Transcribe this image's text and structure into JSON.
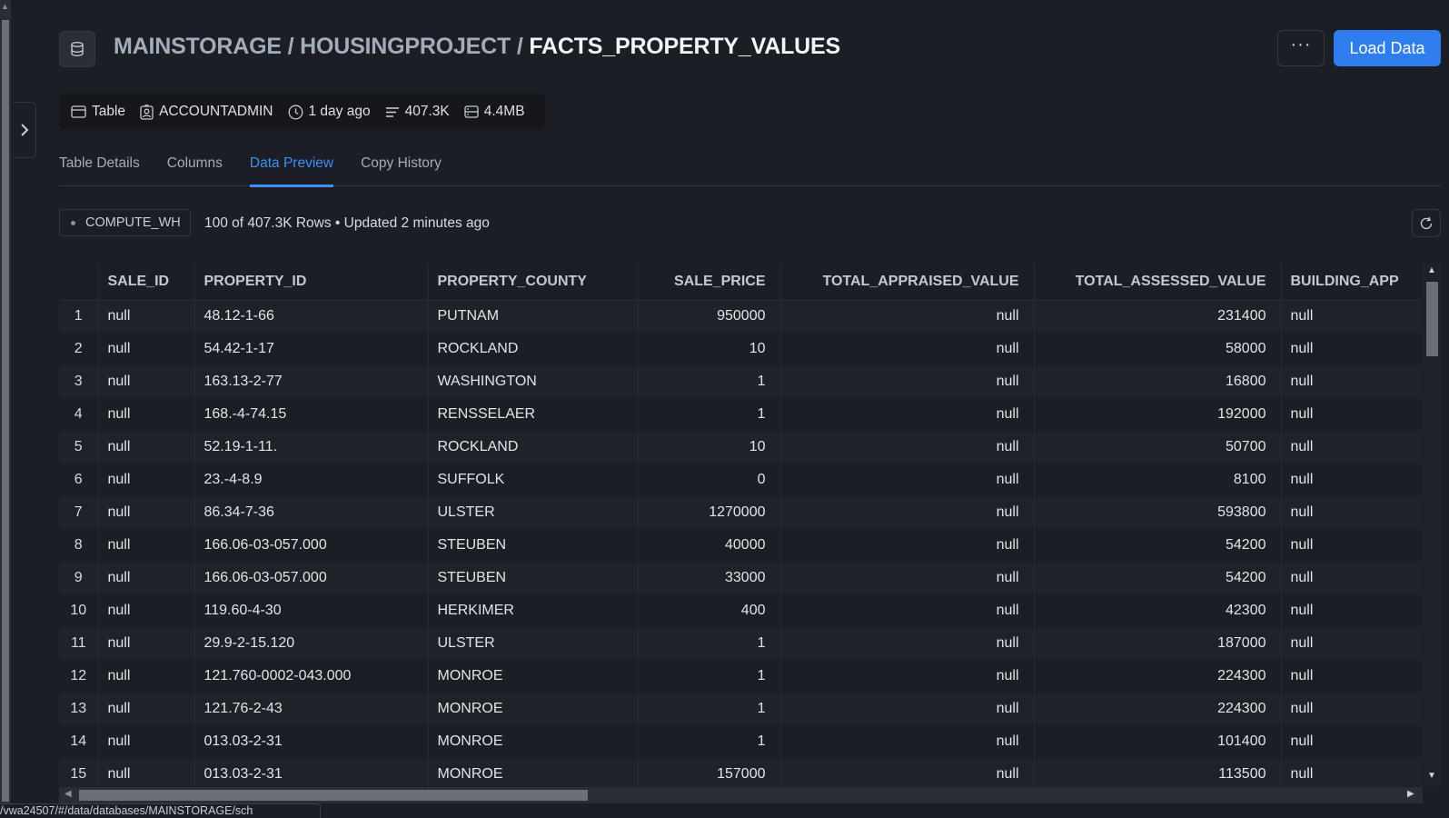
{
  "breadcrumb": {
    "database": "MAINSTORAGE",
    "schema": "HOUSINGPROJECT",
    "table": "FACTS_PROPERTY_VALUES",
    "separator": " / "
  },
  "header": {
    "more_label": "···",
    "load_label": "Load Data"
  },
  "meta": {
    "type": "Table",
    "owner": "ACCOUNTADMIN",
    "modified": "1 day ago",
    "rows": "407.3K",
    "size": "4.4MB"
  },
  "tabs": [
    "Table Details",
    "Columns",
    "Data Preview",
    "Copy History"
  ],
  "active_tab": "Data Preview",
  "preview": {
    "warehouse": "COMPUTE_WH",
    "summary": "100 of 407.3K Rows • Updated 2 minutes ago"
  },
  "table": {
    "columns": [
      "SALE_ID",
      "PROPERTY_ID",
      "PROPERTY_COUNTY",
      "SALE_PRICE",
      "TOTAL_APPRAISED_VALUE",
      "TOTAL_ASSESSED_VALUE",
      "BUILDING_APP"
    ],
    "rows": [
      [
        "1",
        "null",
        "48.12-1-66",
        "PUTNAM",
        "950000",
        "null",
        "231400",
        "null"
      ],
      [
        "2",
        "null",
        "54.42-1-17",
        "ROCKLAND",
        "10",
        "null",
        "58000",
        "null"
      ],
      [
        "3",
        "null",
        "163.13-2-77",
        "WASHINGTON",
        "1",
        "null",
        "16800",
        "null"
      ],
      [
        "4",
        "null",
        "168.-4-74.15",
        "RENSSELAER",
        "1",
        "null",
        "192000",
        "null"
      ],
      [
        "5",
        "null",
        "52.19-1-11.",
        "ROCKLAND",
        "10",
        "null",
        "50700",
        "null"
      ],
      [
        "6",
        "null",
        "23.-4-8.9",
        "SUFFOLK",
        "0",
        "null",
        "8100",
        "null"
      ],
      [
        "7",
        "null",
        "86.34-7-36",
        "ULSTER",
        "1270000",
        "null",
        "593800",
        "null"
      ],
      [
        "8",
        "null",
        "166.06-03-057.000",
        "STEUBEN",
        "40000",
        "null",
        "54200",
        "null"
      ],
      [
        "9",
        "null",
        "166.06-03-057.000",
        "STEUBEN",
        "33000",
        "null",
        "54200",
        "null"
      ],
      [
        "10",
        "null",
        "119.60-4-30",
        "HERKIMER",
        "400",
        "null",
        "42300",
        "null"
      ],
      [
        "11",
        "null",
        "29.9-2-15.120",
        "ULSTER",
        "1",
        "null",
        "187000",
        "null"
      ],
      [
        "12",
        "null",
        "121.760-0002-043.000",
        "MONROE",
        "1",
        "null",
        "224300",
        "null"
      ],
      [
        "13",
        "null",
        "121.76-2-43",
        "MONROE",
        "1",
        "null",
        "224300",
        "null"
      ],
      [
        "14",
        "null",
        "013.03-2-31",
        "MONROE",
        "1",
        "null",
        "101400",
        "null"
      ],
      [
        "15",
        "null",
        "013.03-2-31",
        "MONROE",
        "157000",
        "null",
        "113500",
        "null"
      ]
    ]
  },
  "status_url": "/​vwa24507/#/data/databases/MAINSTORAGE/sch",
  "colors": {
    "background": "#1b1e25",
    "accent": "#2f7ef0",
    "active_tab": "#3d8ff5"
  }
}
